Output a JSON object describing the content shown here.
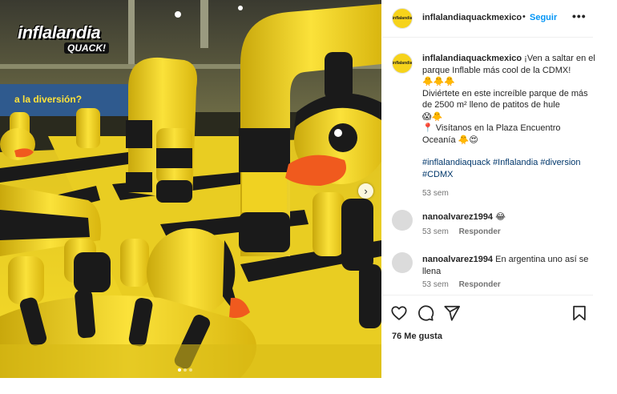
{
  "brand": {
    "name": "inflalandia",
    "sub": "QUACK!"
  },
  "photo": {
    "alt_icons": [
      "chevron-right-icon"
    ]
  },
  "post": {
    "username": "inflalandiaquackmexico",
    "separator": "•",
    "follow_label": "Seguir",
    "more_label": "•••",
    "avatar_text": "inflalandia"
  },
  "caption": {
    "line1": "¡Ven a saltar en el parque Inflable más cool de la CDMX!",
    "emoji1": "🐥🐥🐥",
    "line2": "Diviértete en este increíble parque de más de 2500 m² lleno de patitos de hule",
    "emoji2": "😱🐥",
    "line3": "📍 Visítanos en la Plaza Encuentro Oceanía",
    "emoji3": "🐥😍",
    "tags": "#inflalandiaquack #Inflalandia #diversion #CDMX",
    "time": "53 sem"
  },
  "comments": [
    {
      "user": "nanoalvarez1994",
      "text": "😂",
      "time": "53 sem",
      "reply": "Responder"
    },
    {
      "user": "nanoalvarez1994",
      "text": "En argentina uno así se llena",
      "time": "53 sem",
      "reply": "Responder"
    }
  ],
  "footer": {
    "likes": "76 Me gusta"
  },
  "colors": {
    "accent": "#0095f6",
    "inflatable": "#f3d21a",
    "stripe": "#1a1a1a"
  }
}
